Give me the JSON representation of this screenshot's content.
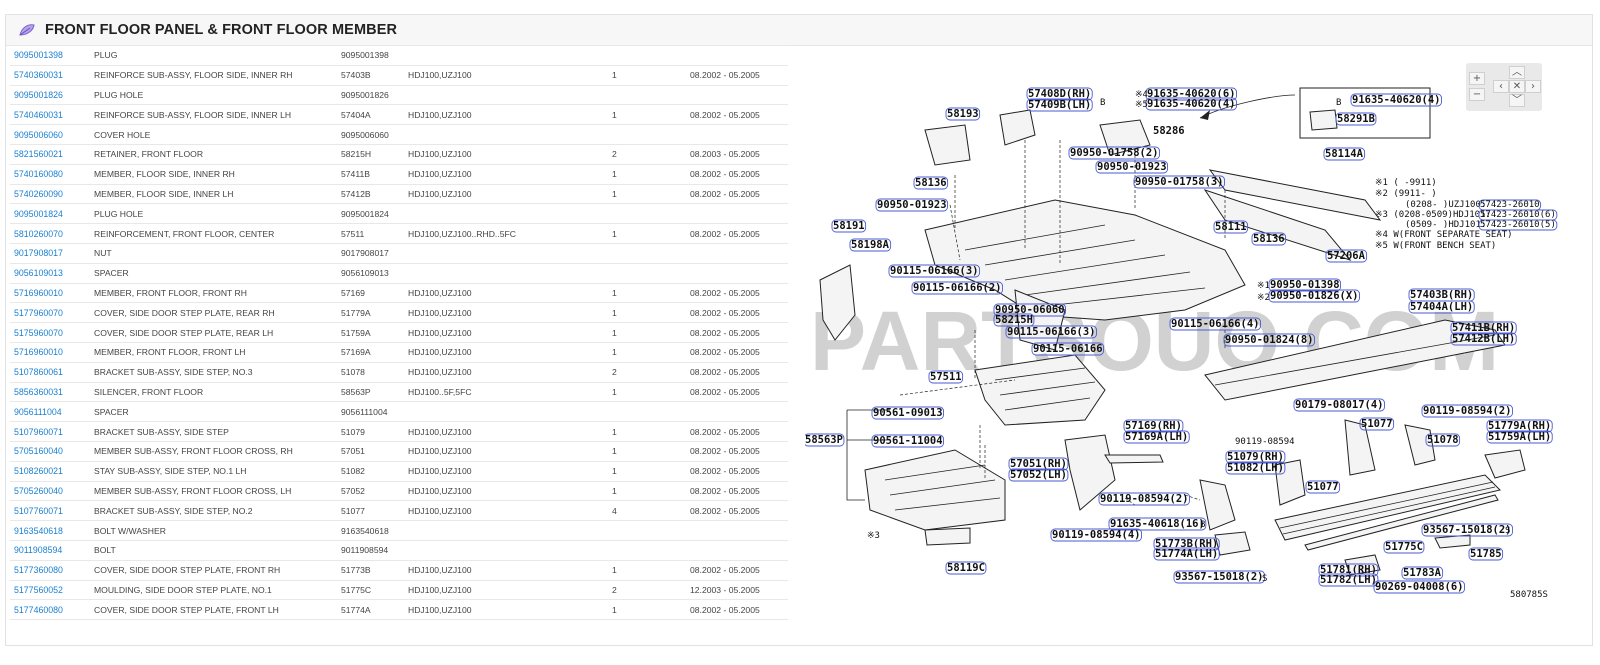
{
  "header": {
    "title": "FRONT FLOOR PANEL & FRONT FLOOR MEMBER",
    "icon": "leaf-icon",
    "accent": "#8a6ad6"
  },
  "table": {
    "rows": [
      {
        "pn": "9095001398",
        "name": "PLUG",
        "code": "9095001398",
        "model": "",
        "qty": "",
        "date": ""
      },
      {
        "pn": "5740360031",
        "name": "REINFORCE SUB-ASSY, FLOOR SIDE, INNER RH",
        "code": "57403B",
        "model": "HDJ100,UZJ100",
        "qty": "1",
        "date": "08.2002 - 05.2005"
      },
      {
        "pn": "9095001826",
        "name": "PLUG HOLE",
        "code": "9095001826",
        "model": "",
        "qty": "",
        "date": ""
      },
      {
        "pn": "5740460031",
        "name": "REINFORCE SUB-ASSY, FLOOR SIDE, INNER LH",
        "code": "57404A",
        "model": "HDJ100,UZJ100",
        "qty": "1",
        "date": "08.2002 - 05.2005"
      },
      {
        "pn": "9095006060",
        "name": "COVER HOLE",
        "code": "9095006060",
        "model": "",
        "qty": "",
        "date": ""
      },
      {
        "pn": "5821560021",
        "name": "RETAINER, FRONT FLOOR",
        "code": "58215H",
        "model": "HDJ100,UZJ100",
        "qty": "2",
        "date": "08.2003 - 05.2005"
      },
      {
        "pn": "5740160080",
        "name": "MEMBER, FLOOR SIDE, INNER RH",
        "code": "57411B",
        "model": "HDJ100,UZJ100",
        "qty": "1",
        "date": "08.2002 - 05.2005"
      },
      {
        "pn": "5740260090",
        "name": "MEMBER, FLOOR SIDE, INNER LH",
        "code": "57412B",
        "model": "HDJ100,UZJ100",
        "qty": "1",
        "date": "08.2002 - 05.2005"
      },
      {
        "pn": "9095001824",
        "name": "PLUG HOLE",
        "code": "9095001824",
        "model": "",
        "qty": "",
        "date": ""
      },
      {
        "pn": "5810260070",
        "name": "REINFORCEMENT, FRONT FLOOR, CENTER",
        "code": "57511",
        "model": "HDJ100,UZJ100..RHD..5FC",
        "qty": "1",
        "date": "08.2002 - 05.2005"
      },
      {
        "pn": "9017908017",
        "name": "NUT",
        "code": "9017908017",
        "model": "",
        "qty": "",
        "date": ""
      },
      {
        "pn": "9056109013",
        "name": "SPACER",
        "code": "9056109013",
        "model": "",
        "qty": "",
        "date": ""
      },
      {
        "pn": "5716960010",
        "name": "MEMBER, FRONT FLOOR, FRONT RH",
        "code": "57169",
        "model": "HDJ100,UZJ100",
        "qty": "1",
        "date": "08.2002 - 05.2005"
      },
      {
        "pn": "5177960070",
        "name": "COVER, SIDE DOOR STEP PLATE, REAR RH",
        "code": "51779A",
        "model": "HDJ100,UZJ100",
        "qty": "1",
        "date": "08.2002 - 05.2005"
      },
      {
        "pn": "5175960070",
        "name": "COVER, SIDE DOOR STEP PLATE, REAR LH",
        "code": "51759A",
        "model": "HDJ100,UZJ100",
        "qty": "1",
        "date": "08.2002 - 05.2005"
      },
      {
        "pn": "5716960010",
        "name": "MEMBER, FRONT FLOOR, FRONT LH",
        "code": "57169A",
        "model": "HDJ100,UZJ100",
        "qty": "1",
        "date": "08.2002 - 05.2005"
      },
      {
        "pn": "5107860061",
        "name": "BRACKET SUB-ASSY, SIDE STEP, NO.3",
        "code": "51078",
        "model": "HDJ100,UZJ100",
        "qty": "2",
        "date": "08.2002 - 05.2005"
      },
      {
        "pn": "5856360031",
        "name": "SILENCER, FRONT FLOOR",
        "code": "58563P",
        "model": "HDJ100..5F,5FC",
        "qty": "1",
        "date": "08.2002 - 05.2005"
      },
      {
        "pn": "9056111004",
        "name": "SPACER",
        "code": "9056111004",
        "model": "",
        "qty": "",
        "date": ""
      },
      {
        "pn": "5107960071",
        "name": "BRACKET SUB-ASSY, SIDE STEP",
        "code": "51079",
        "model": "HDJ100,UZJ100",
        "qty": "1",
        "date": "08.2002 - 05.2005"
      },
      {
        "pn": "5705160040",
        "name": "MEMBER SUB-ASSY, FRONT FLOOR CROSS, RH",
        "code": "57051",
        "model": "HDJ100,UZJ100",
        "qty": "1",
        "date": "08.2002 - 05.2005"
      },
      {
        "pn": "5108260021",
        "name": "STAY SUB-ASSY, SIDE STEP, NO.1 LH",
        "code": "51082",
        "model": "HDJ100,UZJ100",
        "qty": "1",
        "date": "08.2002 - 05.2005"
      },
      {
        "pn": "5705260040",
        "name": "MEMBER SUB-ASSY, FRONT FLOOR CROSS, LH",
        "code": "57052",
        "model": "HDJ100,UZJ100",
        "qty": "1",
        "date": "08.2002 - 05.2005"
      },
      {
        "pn": "5107760071",
        "name": "BRACKET SUB-ASSY, SIDE STEP, NO.2",
        "code": "51077",
        "model": "HDJ100,UZJ100",
        "qty": "4",
        "date": "08.2002 - 05.2005"
      },
      {
        "pn": "9163540618",
        "name": "BOLT W/WASHER",
        "code": "9163540618",
        "model": "",
        "qty": "",
        "date": ""
      },
      {
        "pn": "9011908594",
        "name": "BOLT",
        "code": "9011908594",
        "model": "",
        "qty": "",
        "date": ""
      },
      {
        "pn": "5177360080",
        "name": "COVER, SIDE DOOR STEP PLATE, FRONT RH",
        "code": "51773B",
        "model": "HDJ100,UZJ100",
        "qty": "1",
        "date": "08.2002 - 05.2005"
      },
      {
        "pn": "5177560052",
        "name": "MOULDING, SIDE DOOR STEP PLATE, NO.1",
        "code": "51775C",
        "model": "HDJ100,UZJ100",
        "qty": "2",
        "date": "12.2003 - 05.2005"
      },
      {
        "pn": "5177460080",
        "name": "COVER, SIDE DOOR STEP PLATE, FRONT LH",
        "code": "51774A",
        "model": "HDJ100,UZJ100",
        "qty": "1",
        "date": "08.2002 - 05.2005"
      }
    ]
  },
  "diagram": {
    "watermark": "PARTSOUQ.COM",
    "ref": "580785S",
    "labels": {
      "l57408": "57408D(RH)",
      "l57409": "57409B(LH)",
      "l91635a": "91635-40620(6)",
      "l91635b": "91635-40620(4)",
      "l91635c": "91635-40620(4)",
      "l58291": "58291B",
      "l58286": "58286",
      "l58193": "58193",
      "l90950a": "90950-01758(2)",
      "l90950b": "90950-01923",
      "l90950c": "90950-01758(3)",
      "l58114": "58114A",
      "l58136a": "58136",
      "l90950d": "90950-01923",
      "l58191": "58191",
      "l58198": "58198A",
      "l58111": "58111",
      "l58136b": "58136",
      "l57206": "57206A",
      "l90115a": "90115-06166(3)",
      "l90115b": "90115-06166(2)",
      "l90950e": "90950-01398",
      "l90950f": "90950-01826(X)",
      "l57403": "57403B(RH)",
      "l57404": "57404A(LH)",
      "l90950g": "90950-06060",
      "l58215": "58215H",
      "l90115c": "90115-06166(3)",
      "l90115d": "90115-06166(4)",
      "l90115e": "90115-06166",
      "l90950h": "90950-01824(8)",
      "l57411": "57411B(RH)",
      "l57412": "57412B(LH)",
      "l57511": "57511",
      "l90561a": "90561-09013",
      "l90561b": "90561-11004",
      "l58563": "58563P",
      "l57169": "57169(RH)",
      "l57169a": "57169A(LH)",
      "l90179": "90179-08017(4)",
      "l90119a": "90119-08594(2)",
      "l51077a": "51077",
      "l51779": "51779A(RH)",
      "l51759": "51759A(LH)",
      "l51078": "51078",
      "l90119b": "90119-08594",
      "l57051": "57051(RH)",
      "l57052": "57052(LH)",
      "l51079": "51079(RH)",
      "l51082": "51082(LH)",
      "l51077b": "51077",
      "l90119c": "90119-08594(2)",
      "l91635d": "91635-40618(16)",
      "l90119d": "90119-08594(4)",
      "l93567a": "93567-15018(2)",
      "l51775": "51775C",
      "l51785": "51785",
      "l51773": "51773B(RH)",
      "l51774": "51774A(LH)",
      "l93567b": "93567-15018(2)",
      "l51781": "51781(RH)",
      "l51782": "51782(LH)",
      "l51783": "51783A",
      "l90269": "90269-04008(6)",
      "l58119": "58119C",
      "n1": "※1  (     -9911)",
      "n2": "※2  (9911-     )",
      "n3a": "(0208-     )UZJ100:",
      "n3ap": "57423-26010",
      "n3b": "※3  (0208-0509)HDJ101:",
      "n3bp": "57423-26010(6)",
      "n3c": "(0509-     )HDJ101:",
      "n3cp": "57423-26010(5)",
      "n4": "※4  W(FRONT SEPARATE SEAT)",
      "n5": "※5  W(FRONT BENCH SEAT)",
      "m1": "※1",
      "m2": "※2",
      "m3": "※3",
      "m4": "※4",
      "m5": "※5",
      "cB": "B",
      "cS": "S"
    }
  },
  "zoom": {
    "in": "+",
    "out": "−",
    "up": "︿",
    "down": "﹀",
    "left": "‹",
    "right": "›",
    "reset": "✕"
  }
}
